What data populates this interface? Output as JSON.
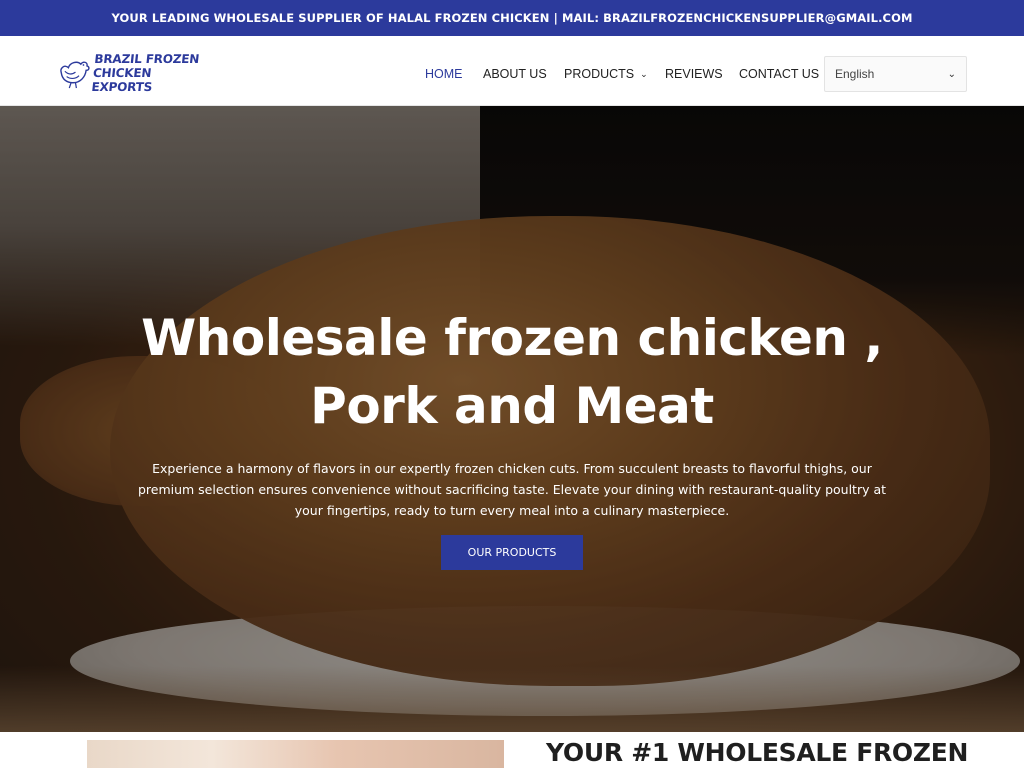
{
  "topbar": {
    "text": "YOUR LEADING WHOLESALE SUPPLIER OF HALAL FROZEN CHICKEN | MAIL: BRAZILFROZENCHICKENSUPPLIER@GMAIL.COM"
  },
  "logo": {
    "line1": "BRAZIL FROZEN",
    "line2": "CHICKEN EXPORTS",
    "icon": "chicken-icon"
  },
  "nav": {
    "items": [
      {
        "label": "HOME",
        "active": true
      },
      {
        "label": "ABOUT US"
      },
      {
        "label": "PRODUCTS",
        "has_dropdown": true
      },
      {
        "label": "REVIEWS"
      },
      {
        "label": "CONTACT US"
      }
    ],
    "language": "English"
  },
  "hero": {
    "title_line1": "Wholesale frozen chicken ,",
    "title_line2": "Pork and Meat",
    "description": "Experience a harmony of flavors in our expertly frozen chicken cuts. From succulent breasts to flavorful thighs, our premium selection ensures convenience without sacrificing taste. Elevate your dining with restaurant-quality poultry at your fingertips, ready to turn every meal into a culinary masterpiece.",
    "button_label": "OUR PRODUCTS"
  },
  "section": {
    "heading": "YOUR #1 WHOLESALE FROZEN"
  },
  "colors": {
    "primary": "#2c3a9c",
    "topbar_bg": "#2c3a9c",
    "text_dark": "#222222"
  }
}
